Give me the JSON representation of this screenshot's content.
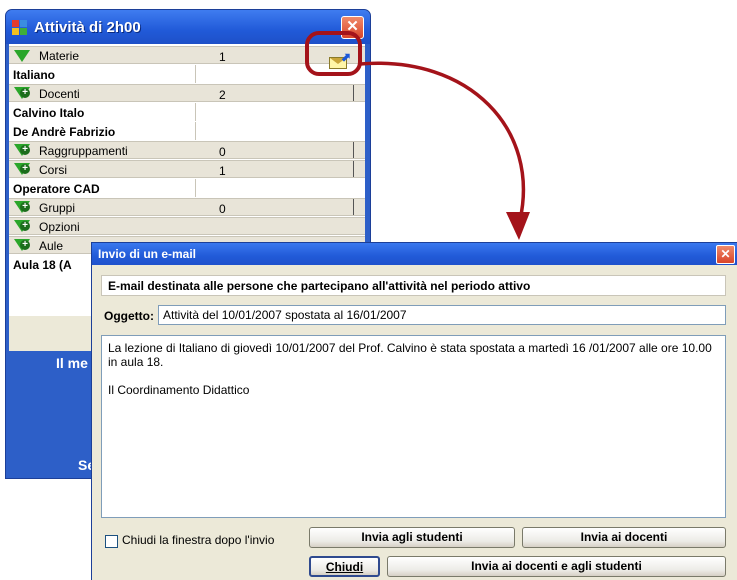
{
  "window": {
    "title": "Attività di  2h00",
    "rows": [
      {
        "type": "head",
        "icon": "expanded-triangle-icon",
        "label": "Materie",
        "count": "1"
      },
      {
        "type": "item",
        "label": "Italiano"
      },
      {
        "type": "head",
        "icon": "add-icon",
        "label": "Docenti",
        "count": "2"
      },
      {
        "type": "item",
        "label": "Calvino Italo"
      },
      {
        "type": "item",
        "label": "De Andrè Fabrizio"
      },
      {
        "type": "head",
        "icon": "add-icon",
        "label": "Raggruppamenti",
        "count": "0"
      },
      {
        "type": "head",
        "icon": "add-icon",
        "label": "Corsi",
        "count": "1"
      },
      {
        "type": "item",
        "label": "Operatore CAD"
      },
      {
        "type": "head",
        "icon": "add-icon",
        "label": "Gruppi",
        "count": "0"
      },
      {
        "type": "head",
        "icon": "add-icon",
        "label": "Opzioni",
        "count": ""
      },
      {
        "type": "head",
        "icon": "add-icon",
        "label": "Aule",
        "count": ""
      },
      {
        "type": "item",
        "label": "Aula 18 (A"
      }
    ],
    "message_1": "Il me",
    "message_2": "Se"
  },
  "dialog": {
    "title": "Invio di un e-mail",
    "info": "E-mail destinata alle persone che partecipano all'attività nel periodo attivo",
    "subject_label": "Oggetto:",
    "subject": "Attività del 10/01/2007 spostata al 16/01/2007",
    "body": "La lezione di Italiano di giovedì 10/01/2007 del Prof. Calvino è stata spostata a martedì 16 /01/2007 alle ore 10.00 in aula 18.\n\nIl Coordinamento Didattico",
    "checkbox_label": "Chiudi la finestra dopo l'invio",
    "btn_students": "Invia agli studenti",
    "btn_teachers": "Invia ai docenti",
    "btn_close": "Chiudi",
    "btn_both": "Invia ai docenti e agli studenti"
  },
  "colors": {
    "title_bar": "#215ad8",
    "highlight": "#a4131a",
    "expand_icon": "#2aa62a"
  }
}
